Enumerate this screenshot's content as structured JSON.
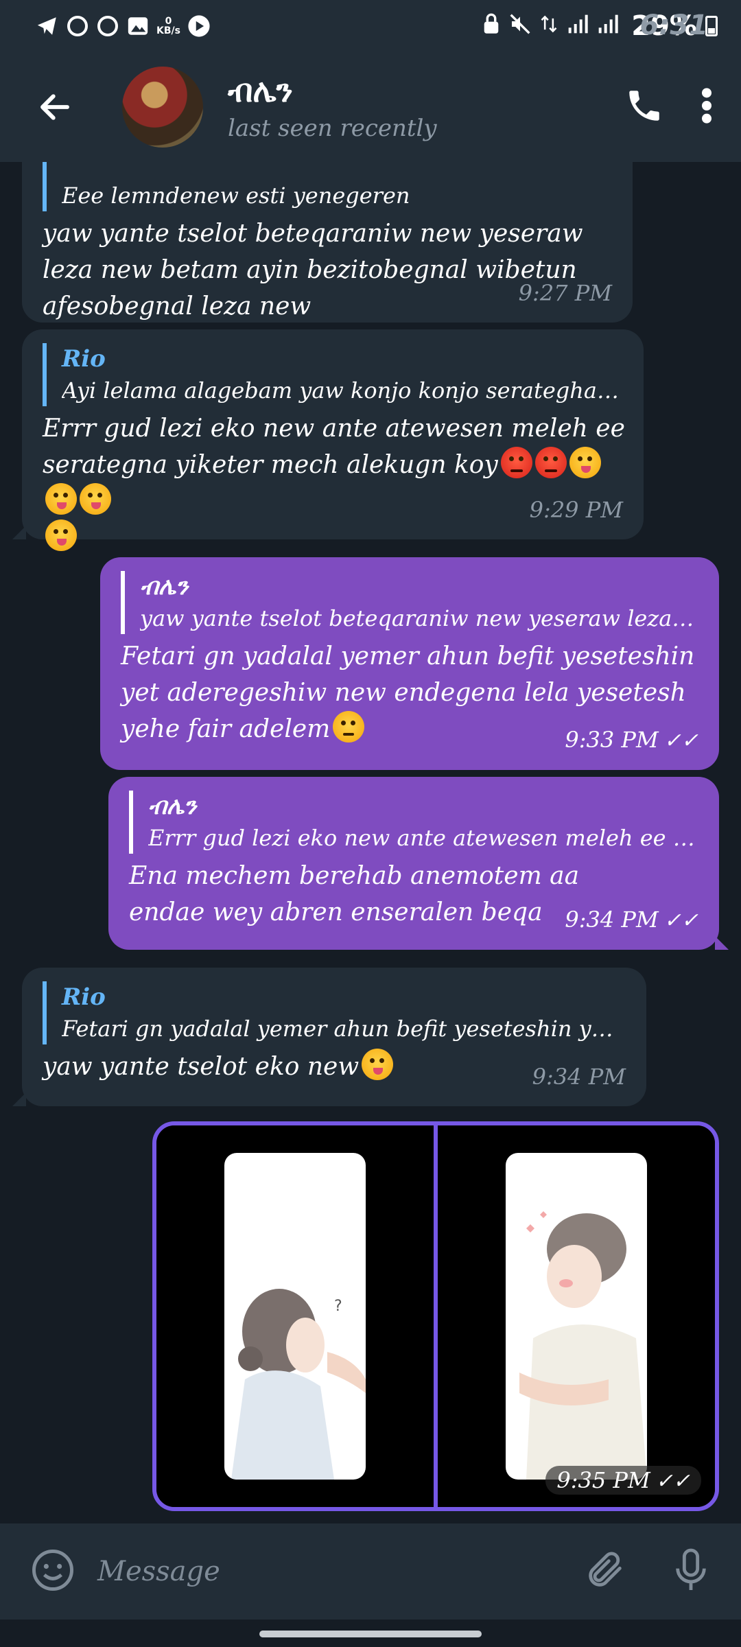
{
  "status_bar": {
    "time": "6:31",
    "net_speed": "0",
    "net_unit": "KB/s",
    "battery": "29%"
  },
  "header": {
    "name": "ብሌን",
    "status": "last seen recently"
  },
  "messages": [
    {
      "quote_text": "Eee lemndenew esti yenegeren",
      "text": "yaw yante tselot beteqaraniw new yeseraw leza new betam ayin bezitobegnal wibetun afesobegnal leza new",
      "time": "9:27 PM"
    },
    {
      "quote_name": "Rio",
      "quote_text": "Ayi lelama alagebam yaw konjo konjo serategha enket...",
      "text": "Errr gud lezi eko new ante atewesen meleh ee serategna yiketer mech alekugn koy",
      "time": "9:29 PM"
    },
    {
      "quote_name": "ብሌን",
      "quote_text": "yaw yante tselot beteqaraniw new yeseraw leza new b...",
      "text": "Fetari gn yadalal yemer ahun befit yeseteshin yet aderegeshiw new endegena lela yesetesh yehe fair adelem",
      "time": "9:33 PM"
    },
    {
      "quote_name": "ብሌን",
      "quote_text": "Errr gud lezi eko new ante atewesen meleh ee serateg...",
      "text": "Ena mechem berehab anemotem aa endae wey abren enseralen beqa",
      "time": "9:34 PM"
    },
    {
      "quote_name": "Rio",
      "quote_text": "Fetari gn yadalal yemer ahun befit yeseteshin yet ader...",
      "text": "yaw yante tselot eko new",
      "time": "9:34 PM"
    }
  ],
  "image_message": {
    "time": "9:35 PM"
  },
  "input": {
    "placeholder": "Message"
  },
  "colors": {
    "incoming_bubble": "#222d37",
    "outgoing_bubble": "#7f4cc0",
    "quote_accent": "#64b5f6",
    "image_border": "#7658e6",
    "background": "#151c24"
  }
}
